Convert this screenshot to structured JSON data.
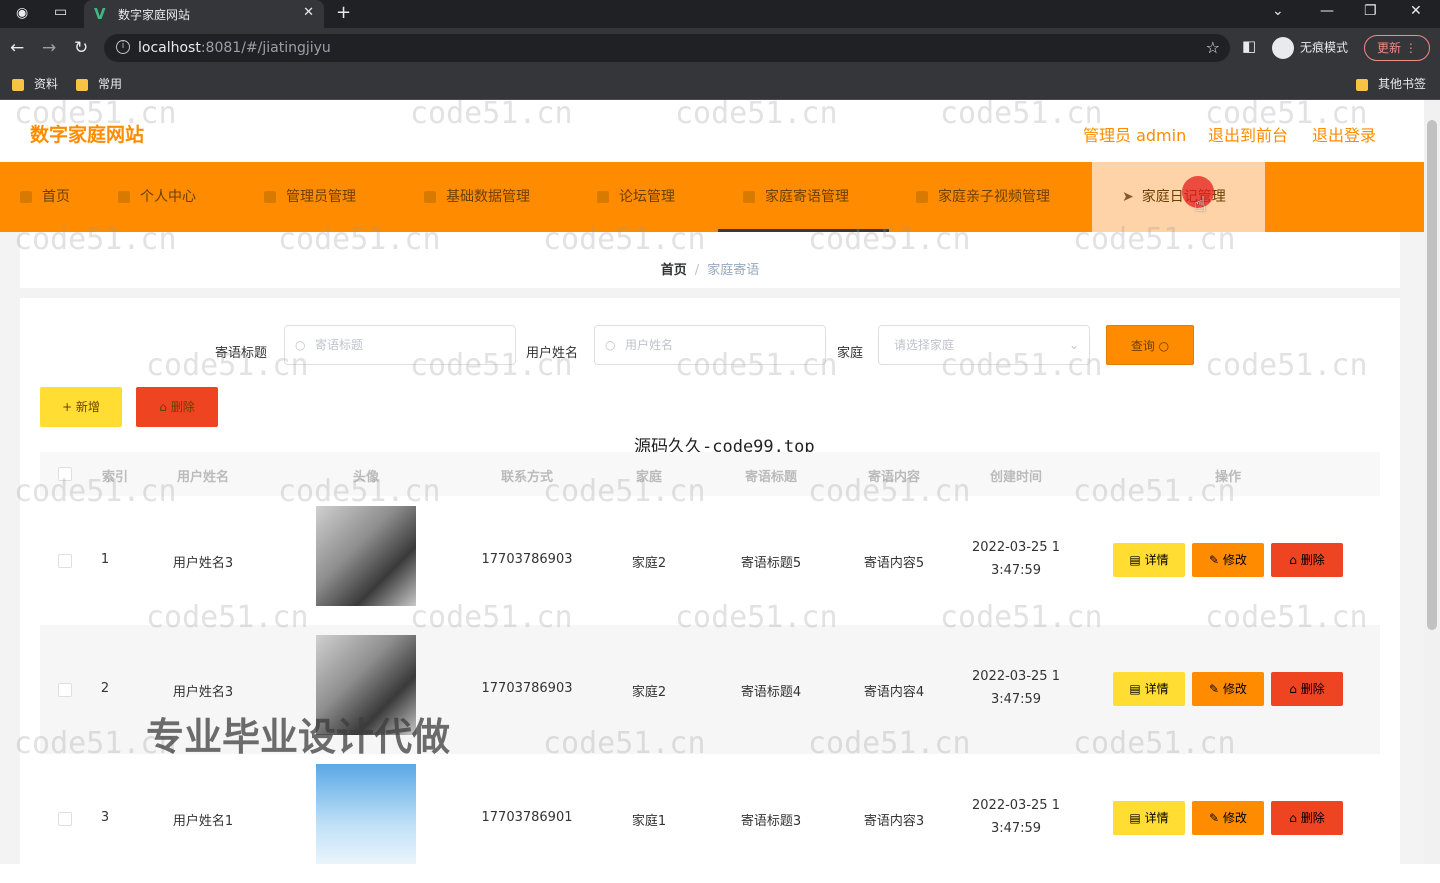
{
  "browser": {
    "tab_title": "数字家庭网站",
    "url_host": "localhost",
    "url_rest": ":8081/#/jiatingjiyu",
    "incognito_label": "无痕模式",
    "update_label": "更新",
    "bookmarks": [
      "资料",
      "常用"
    ],
    "other_bookmarks": "其他书签"
  },
  "header": {
    "brand": "数字家庭网站",
    "links": [
      "管理员 admin",
      "退出到前台",
      "退出登录"
    ]
  },
  "nav": {
    "items": [
      "首页",
      "个人中心",
      "管理员管理",
      "基础数据管理",
      "论坛管理",
      "家庭寄语管理",
      "家庭亲子视频管理",
      "家庭日记管理"
    ]
  },
  "breadcrumb": {
    "home": "首页",
    "separator": "/",
    "current": "家庭寄语"
  },
  "search": {
    "title_label": "寄语标题",
    "title_placeholder": "寄语标题",
    "user_label": "用户姓名",
    "user_placeholder": "用户姓名",
    "family_label": "家庭",
    "family_placeholder": "请选择家庭",
    "query_button": "查询"
  },
  "actions": {
    "add": "+ 新增",
    "delete": "删除"
  },
  "watermark_text": "源码久久-code99.top",
  "watermark_repeat": "code51.cn",
  "big_watermark": "专业毕业设计代做",
  "table": {
    "headers": [
      "索引",
      "用户姓名",
      "头像",
      "联系方式",
      "家庭",
      "寄语标题",
      "寄语内容",
      "创建时间",
      "操作"
    ],
    "rows": [
      {
        "index": "1",
        "user": "用户姓名3",
        "phone": "17703786903",
        "family": "家庭2",
        "title": "寄语标题5",
        "content": "寄语内容5",
        "time1": "2022-03-25 1",
        "time2": "3:47:59"
      },
      {
        "index": "2",
        "user": "用户姓名3",
        "phone": "17703786903",
        "family": "家庭2",
        "title": "寄语标题4",
        "content": "寄语内容4",
        "time1": "2022-03-25 1",
        "time2": "3:47:59"
      },
      {
        "index": "3",
        "user": "用户姓名1",
        "phone": "17703786901",
        "family": "家庭1",
        "title": "寄语标题3",
        "content": "寄语内容3",
        "time1": "2022-03-25 1",
        "time2": "3:47:59"
      }
    ],
    "row_buttons": {
      "detail": "详情",
      "edit": "修改",
      "delete": "删除"
    }
  },
  "colors": {
    "accent": "#ff8c00",
    "detail_btn": "#ffdd33",
    "edit_btn": "#ff8c00",
    "delete_btn": "#ee4422"
  }
}
